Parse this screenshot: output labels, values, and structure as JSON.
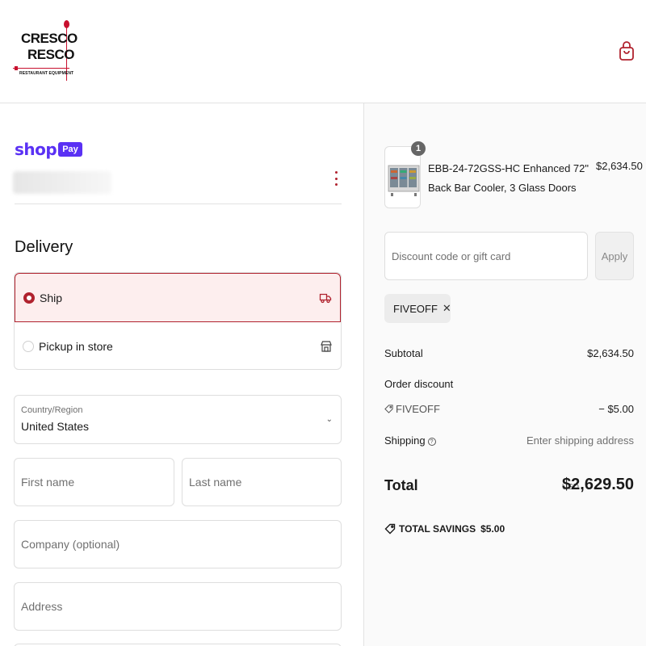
{
  "header": {
    "logo": {
      "line1": "CRESCO",
      "line2": "RESCO",
      "tagline": "RESTAURANT EQUIPMENT"
    },
    "cart_icon": "shopping-bag-icon",
    "accent_color": "#b0222e"
  },
  "shop_pay": {
    "shop": "shop",
    "pay": "Pay",
    "brand_color": "#5a31f4"
  },
  "delivery": {
    "title": "Delivery",
    "options": [
      {
        "label": "Ship",
        "selected": true,
        "icon": "truck-icon"
      },
      {
        "label": "Pickup in store",
        "selected": false,
        "icon": "store-icon"
      }
    ]
  },
  "form": {
    "country_label": "Country/Region",
    "country_value": "United States",
    "first_name_placeholder": "First name",
    "last_name_placeholder": "Last name",
    "company_placeholder": "Company (optional)",
    "address_placeholder": "Address"
  },
  "order": {
    "item": {
      "quantity": "1",
      "name": "EBB-24-72GSS-HC Enhanced 72\" Back Bar Cooler, 3 Glass Doors",
      "price": "$2,634.50"
    },
    "discount_placeholder": "Discount code or gift card",
    "apply_label": "Apply",
    "applied_code": "FIVEOFF",
    "subtotal_label": "Subtotal",
    "subtotal_value": "$2,634.50",
    "order_discount_label": "Order discount",
    "discount_code": "FIVEOFF",
    "discount_value": "− $5.00",
    "shipping_label": "Shipping",
    "shipping_value": "Enter shipping address",
    "total_label": "Total",
    "currency": "USD",
    "total_value": "$2,629.50",
    "savings_label": "TOTAL SAVINGS",
    "savings_value": "$5.00"
  }
}
